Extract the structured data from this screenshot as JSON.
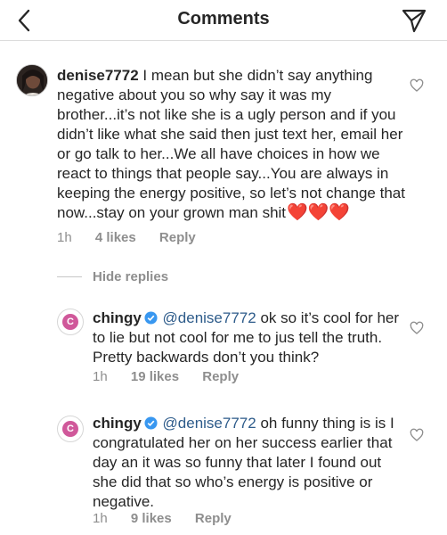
{
  "header": {
    "title": "Comments",
    "back_icon": "chevron-left-icon",
    "share_icon": "paper-plane-icon"
  },
  "comments": [
    {
      "username": "denise7772",
      "text": "I mean but she didn’t say anything negative about you so why say it was my brother...it’s not like she is a ugly person and if you didn’t like what she said then just text her, email her or go talk to her...We all have choices in how we react to things that people say...You are always in keeping the energy positive, so let’s not change that now...stay on your grown man shit",
      "emoji": "❤️❤️❤️",
      "time": "1h",
      "likes": "4 likes",
      "reply": "Reply"
    }
  ],
  "hide_replies": "Hide replies",
  "replies": [
    {
      "username": "chingy",
      "verified": true,
      "mention": "@denise7772",
      "text": "ok so it’s cool for her to lie but not cool for me to jus tell the truth. Pretty backwards don’t you think?",
      "time": "1h",
      "likes": "19 likes",
      "reply": "Reply"
    },
    {
      "username": "chingy",
      "verified": true,
      "mention": "@denise7772",
      "text": "oh funny thing is is I congratulated her on her success earlier that day an it was so funny that later I found out she did that so who’s energy is positive or negative.",
      "time": "1h",
      "likes": "9 likes",
      "reply": "Reply"
    }
  ],
  "colors": {
    "mention": "#2d5b8a",
    "verified": "#3897f0",
    "meta": "#8e8e8e",
    "heart": "#e0213a"
  }
}
